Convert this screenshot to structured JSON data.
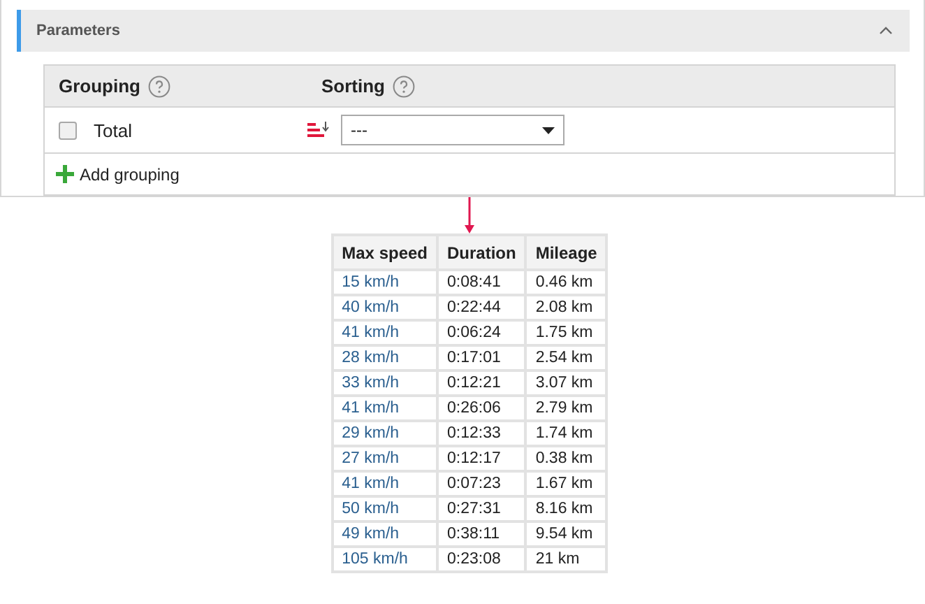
{
  "panel": {
    "title": "Parameters",
    "expanded": true
  },
  "grouping": {
    "columns": [
      {
        "label": "Grouping"
      },
      {
        "label": "Sorting"
      }
    ],
    "rows": [
      {
        "label": "Total",
        "checked": false,
        "sort_value": "---"
      }
    ],
    "add_label": "Add grouping"
  },
  "table": {
    "columns": [
      "Max speed",
      "Duration",
      "Mileage"
    ],
    "rows": [
      [
        "15 km/h",
        "0:08:41",
        "0.46 km"
      ],
      [
        "40 km/h",
        "0:22:44",
        "2.08 km"
      ],
      [
        "41 km/h",
        "0:06:24",
        "1.75 km"
      ],
      [
        "28 km/h",
        "0:17:01",
        "2.54 km"
      ],
      [
        "33 km/h",
        "0:12:21",
        "3.07 km"
      ],
      [
        "41 km/h",
        "0:26:06",
        "2.79 km"
      ],
      [
        "29 km/h",
        "0:12:33",
        "1.74 km"
      ],
      [
        "27 km/h",
        "0:12:17",
        "0.38 km"
      ],
      [
        "41 km/h",
        "0:07:23",
        "1.67 km"
      ],
      [
        "50 km/h",
        "0:27:31",
        "8.16 km"
      ],
      [
        "49 km/h",
        "0:38:11",
        "9.54 km"
      ],
      [
        "105 km/h",
        "0:23:08",
        "21 km"
      ]
    ]
  }
}
